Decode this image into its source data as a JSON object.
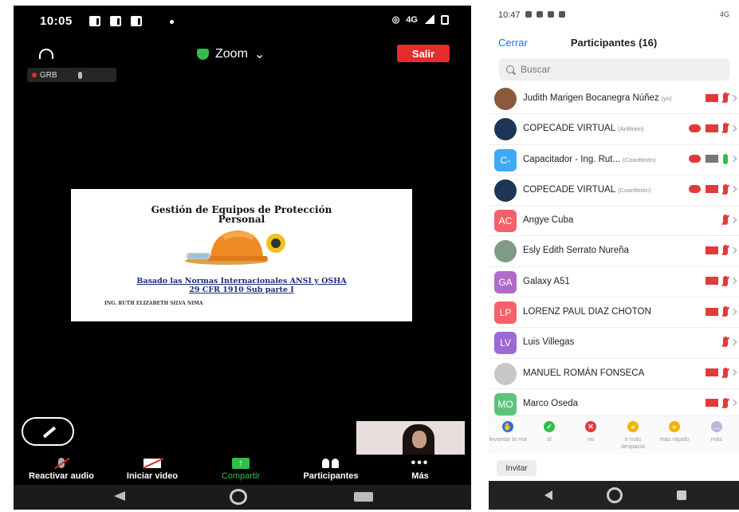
{
  "left_phone": {
    "status_time": "10:05",
    "status_network": "4G",
    "meeting_title": "Zoom",
    "leave_label": "Salir",
    "recording_label": "GRB",
    "slide": {
      "title_line1": "Gestión de Equipos de Protección",
      "title_line2": "Personal",
      "subtitle_line1": "Basado las Normas Internacionales  ANSI y OSHA",
      "subtitle_line2": "29 CFR 1910 Sub parte I",
      "author": "ING. RUTH ELIZABETH SILVA NIMA"
    },
    "toolbar": {
      "audio": "Reactivar audio",
      "video": "Iniciar video",
      "share": "Compartir",
      "participants": "Participantes",
      "more": "Más"
    }
  },
  "right_phone": {
    "status_time": "10:47",
    "status_network": "4G",
    "close_label": "Cerrar",
    "title": "Participantes (16)",
    "search_placeholder": "Buscar",
    "participants": [
      {
        "name": "Judith Marigen Bocanegra Núñez",
        "role": "(yo)",
        "avatar": "",
        "avatar_color": "#8b5a3c",
        "cloud": false,
        "video": false,
        "mic": false
      },
      {
        "name": "COPECADE VIRTUAL",
        "role": "(Anfitrión)",
        "avatar": "",
        "avatar_color": "#1d3557",
        "cloud": true,
        "video": false,
        "mic": false
      },
      {
        "name": "Capacitador - Ing. Rut...",
        "role": "(Coanfitrión)",
        "avatar": "C-",
        "avatar_color": "#3fa9f5",
        "cloud": true,
        "video": true,
        "mic": true
      },
      {
        "name": "COPECADE VIRTUAL",
        "role": "(Coanfitrión)",
        "avatar": "",
        "avatar_color": "#1d3557",
        "cloud": true,
        "video": false,
        "mic": false
      },
      {
        "name": "Angye Cuba",
        "role": "",
        "avatar": "AC",
        "avatar_color": "#f4606c",
        "cloud": false,
        "video": null,
        "mic": false
      },
      {
        "name": "Esly Edith Serrato Nureña",
        "role": "",
        "avatar": "",
        "avatar_color": "#7f9b86",
        "cloud": false,
        "video": false,
        "mic": false
      },
      {
        "name": "Galaxy A51",
        "role": "",
        "avatar": "GA",
        "avatar_color": "#b06ac9",
        "cloud": false,
        "video": false,
        "mic": false
      },
      {
        "name": "LORENZ PAUL DIAZ CHOTON",
        "role": "",
        "avatar": "LP",
        "avatar_color": "#f4606c",
        "cloud": false,
        "video": false,
        "mic": false
      },
      {
        "name": "Luis Villegas",
        "role": "",
        "avatar": "LV",
        "avatar_color": "#9b6ad6",
        "cloud": false,
        "video": null,
        "mic": false
      },
      {
        "name": "MANUEL ROMÁN FONSECA",
        "role": "",
        "avatar": "",
        "avatar_color": "#c7c7c7",
        "cloud": false,
        "video": false,
        "mic": false
      },
      {
        "name": "Marco Oseda",
        "role": "",
        "avatar": "MO",
        "avatar_color": "#5cc47a",
        "cloud": false,
        "video": false,
        "mic": false
      }
    ],
    "reactions": [
      {
        "label": "levantar la ma",
        "color": "#2b6ed8",
        "glyph": "✋"
      },
      {
        "label": "sí",
        "color": "#2fbf4a",
        "glyph": "✓"
      },
      {
        "label": "no",
        "color": "#e03a3a",
        "glyph": "✕"
      },
      {
        "label": "ir más despacio",
        "color": "#f0b400",
        "glyph": "«"
      },
      {
        "label": "más rápido",
        "color": "#f0b400",
        "glyph": "»"
      },
      {
        "label": "más",
        "color": "#b8b8e0",
        "glyph": "…"
      }
    ],
    "invite_label": "Invitar"
  }
}
